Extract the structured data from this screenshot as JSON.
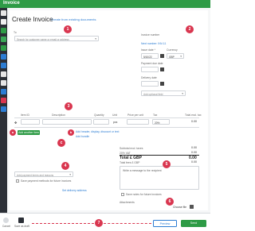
{
  "app": {
    "title": "Invoice"
  },
  "colors": {
    "accent_green": "#2e9b46",
    "badge_red": "#d9364f",
    "link_blue": "#2b7cd3",
    "primary_blue": "#2b7cd3"
  },
  "sidebar": {
    "items": [
      {
        "icon": "home-icon",
        "color": "#e6e6e6"
      },
      {
        "icon": "documents-icon",
        "color": "#f0f0f0"
      },
      {
        "icon": "invoice-icon",
        "color": "#2e9b46"
      },
      {
        "icon": "contacts-icon",
        "color": "#3aa757"
      },
      {
        "icon": "list-icon",
        "color": "#2e9b46"
      },
      {
        "icon": "inbox-icon",
        "color": "#2b7cd3"
      },
      {
        "icon": "bank-icon",
        "color": "#2b7cd3"
      },
      {
        "icon": "reports-icon",
        "color": "#e6e6e6"
      },
      {
        "icon": "settings-icon",
        "color": "#e6e6e6"
      },
      {
        "icon": "apps-icon",
        "color": "#2b7cd3"
      },
      {
        "icon": "alert-icon",
        "color": "#d9364f"
      },
      {
        "icon": "user-icon",
        "color": "#2b7cd3"
      }
    ]
  },
  "header": {
    "title": "Create Invoice",
    "subtitle_link": "Create from existing documents"
  },
  "to_section": {
    "label": "To",
    "placeholder": "Search for customer name or email or address"
  },
  "invoice_meta": {
    "invoice_number_label": "Invoice number",
    "invoice_number_value": "Next number: INV-11",
    "issue_date_label": "Issue date *",
    "issue_date_value": "5/10/22",
    "currency_label": "Currency",
    "currency_value": "GBP",
    "payment_due_label": "Payment due date",
    "delivery_date_label": "Delivery date",
    "optional_field": "Add optional field"
  },
  "line_items": {
    "headers": {
      "item_id": "Item ID",
      "description": "Description",
      "quantity": "Quantity",
      "unit": "Unit",
      "price_per_unit": "Price per unit",
      "tax": "Tax",
      "total_excl_tax": "Total excl. tax"
    },
    "unit_value": "pcs",
    "tax_value": "20%",
    "total_value": "0.00",
    "add_item_button": "Add another item",
    "add_header_link": "Add header, display, discount or text",
    "add_bundle_link": "Add bundle"
  },
  "totals": {
    "subtotal_label": "Subtotal excl. taxes",
    "subtotal_value": "0.00",
    "vat_label": "20% VAT",
    "vat_value": "0.00",
    "total_label": "Total £ GBP",
    "total_value": "0.00",
    "total_fees_label": "Total fees £ GBP",
    "total_fees_value": "0.00"
  },
  "payment": {
    "select_placeholder": "Add payment terms and reasons",
    "save_checkbox_label": "Save payment methods for future invoices",
    "delivery_link": "Set delivery address"
  },
  "message": {
    "placeholder": "Write a message to the recipient",
    "save_notes_label": "Save notes for future invoices"
  },
  "attachments": {
    "label": "Attachments",
    "choose_file": "Choose file"
  },
  "footer": {
    "cancel_label": "Cancel",
    "draft_label": "Save as draft",
    "preview_label": "Preview",
    "send_label": "Send"
  },
  "badges": [
    "1",
    "2",
    "3",
    "4",
    "5",
    "6",
    "7",
    "a",
    "b",
    "c"
  ]
}
